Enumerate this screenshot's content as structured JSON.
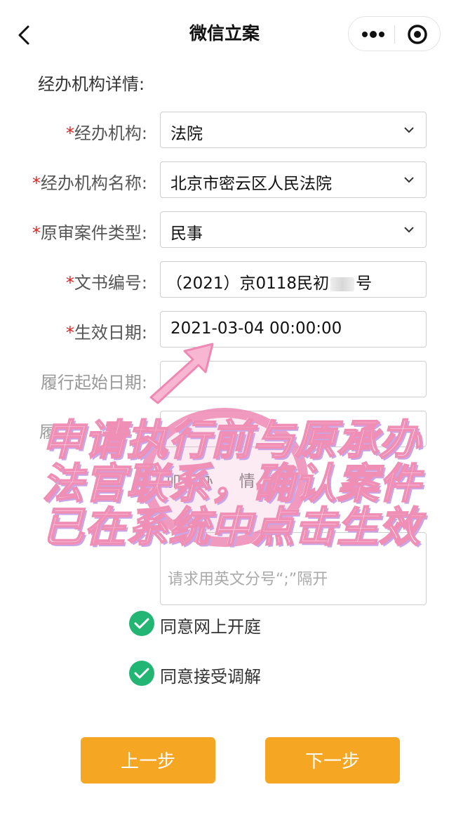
{
  "nav": {
    "title": "微信立案",
    "more_icon": "more-dots-icon",
    "close_icon": "target-close-icon",
    "back_icon": "chevron-left-icon"
  },
  "section": {
    "title": "经办机构详情:"
  },
  "form": {
    "org": {
      "label": "经办机构:",
      "value": "法院"
    },
    "org_name": {
      "label": "经办机构名称:",
      "value": "北京市密云区人民法院"
    },
    "case_type": {
      "label": "原审案件类型:",
      "value": "民事"
    },
    "doc_no": {
      "label": "文书编号:",
      "value": "（2021）京0118民初",
      "suffix": "号"
    },
    "effective_date": {
      "label": "生效日期:",
      "value": "2021-03-04 00:00:00"
    },
    "perform_start": {
      "label": "履行起始日期:",
      "value": ""
    },
    "partial_label": "履",
    "add_detail": "加经办",
    "add_detail_end": "情",
    "notes_placeholder": "请求用英文分号“;”隔开"
  },
  "checks": [
    {
      "label": "同意网上开庭",
      "checked": true
    },
    {
      "label": "同意接受调解",
      "checked": true
    }
  ],
  "buttons": {
    "prev": "上一步",
    "next": "下一步"
  },
  "overlay": {
    "lines": [
      "申请执行前与原承办",
      "法官联系，确认案件",
      "已在系统中点击生效"
    ]
  },
  "colors": {
    "required": "#dd2222",
    "check": "#23b573",
    "button": "#f5a623",
    "overlay_fill": "#ffe9f4",
    "overlay_stroke": "#f08fb5"
  }
}
